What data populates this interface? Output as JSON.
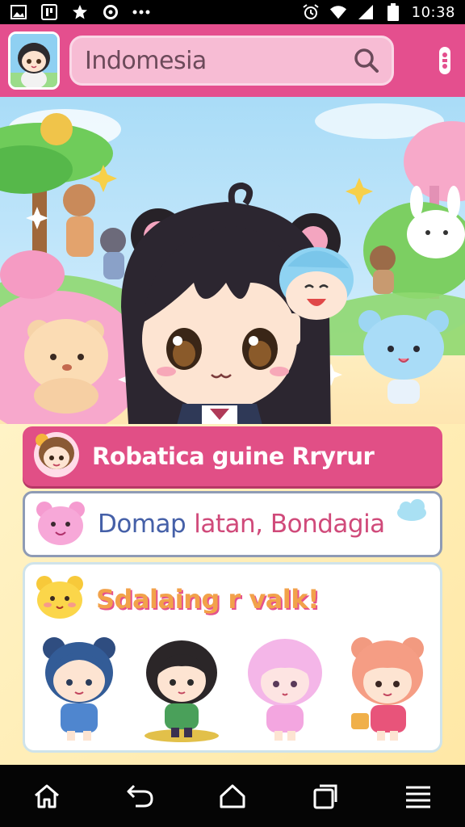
{
  "status_bar": {
    "time": "10:38",
    "left_icons": [
      "image-icon",
      "app-icon",
      "star-icon",
      "circle-icon",
      "more-dots-icon"
    ],
    "right_icons": [
      "alarm-icon",
      "wifi-icon",
      "signal-icon",
      "battery-icon"
    ]
  },
  "app_bar": {
    "search_value": "Indomesia",
    "search_icon": "search-icon",
    "menu_icon": "more-vertical-icon",
    "accent": "#e44f8e"
  },
  "cards": {
    "card_a": {
      "label": "Robatica guine Rryrur"
    },
    "card_b": {
      "label_part1": "Domap",
      "label_part2": "latan, Bondagia"
    },
    "card_c": {
      "title": "Sdalaing r valk!"
    }
  },
  "nav_bar": {
    "items": [
      "home-icon",
      "back-icon",
      "home-outline-icon",
      "recents-icon",
      "menu-icon"
    ]
  },
  "colors": {
    "pink": "#e14f86",
    "blue_text": "#4560a8",
    "pink_text": "#d04a7a",
    "orange_text": "#f2a24a"
  }
}
